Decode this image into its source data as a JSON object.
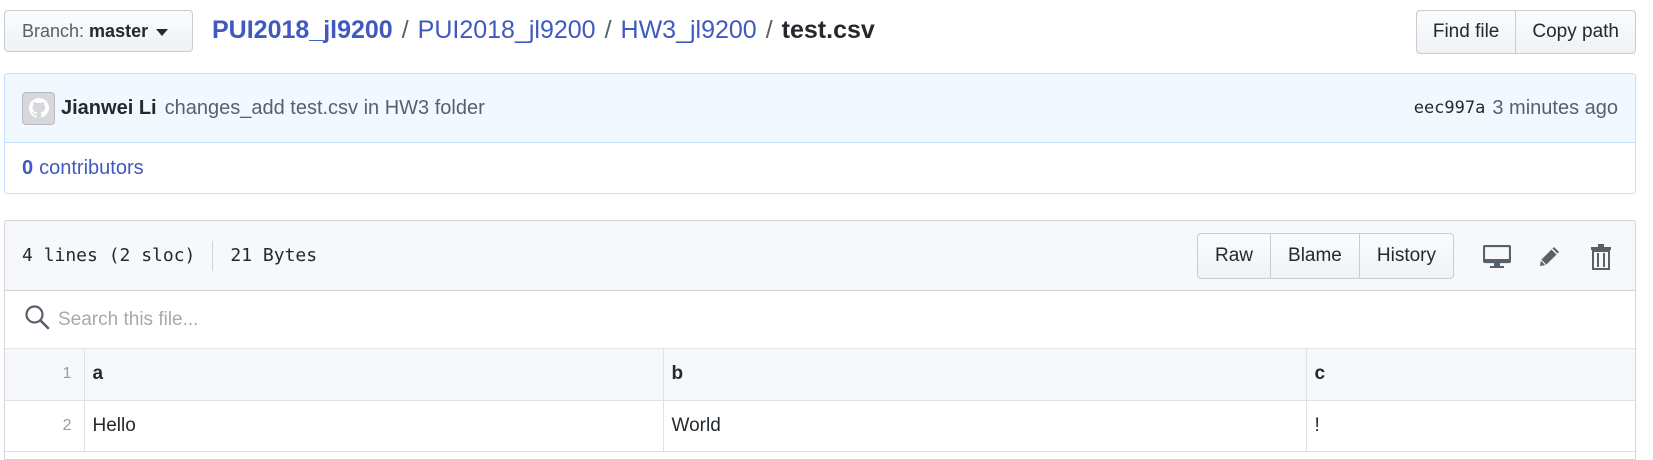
{
  "branch": {
    "prefix": "Branch:",
    "name": "master"
  },
  "breadcrumb": {
    "items": [
      "PUI2018_jl9200",
      "PUI2018_jl9200",
      "HW3_jl9200"
    ],
    "separator": "/",
    "current": "test.csv"
  },
  "top_actions": {
    "find_file": "Find file",
    "copy_path": "Copy path"
  },
  "commit": {
    "author": "Jianwei Li",
    "message": "changes_add test.csv in HW3 folder",
    "sha": "eec997a",
    "time": "3 minutes ago",
    "contributors_count": "0",
    "contributors_label": "contributors"
  },
  "file": {
    "lines": "4 lines (2 sloc)",
    "size": "21 Bytes",
    "buttons": {
      "raw": "Raw",
      "blame": "Blame",
      "history": "History"
    },
    "icons": [
      "desktop-icon",
      "pencil-icon",
      "trashcan-icon"
    ]
  },
  "search": {
    "placeholder": "Search this file..."
  },
  "table": {
    "header_line": "1",
    "headers": [
      "a",
      "b",
      "c"
    ],
    "rows": [
      {
        "line": "2",
        "cells": [
          "Hello",
          "World",
          "!"
        ]
      }
    ]
  },
  "colors": {
    "link": "#4059bf",
    "commit_bg": "#f1f8ff",
    "commit_border": "#c8e1ff",
    "header_bg": "#f6f8fa"
  }
}
